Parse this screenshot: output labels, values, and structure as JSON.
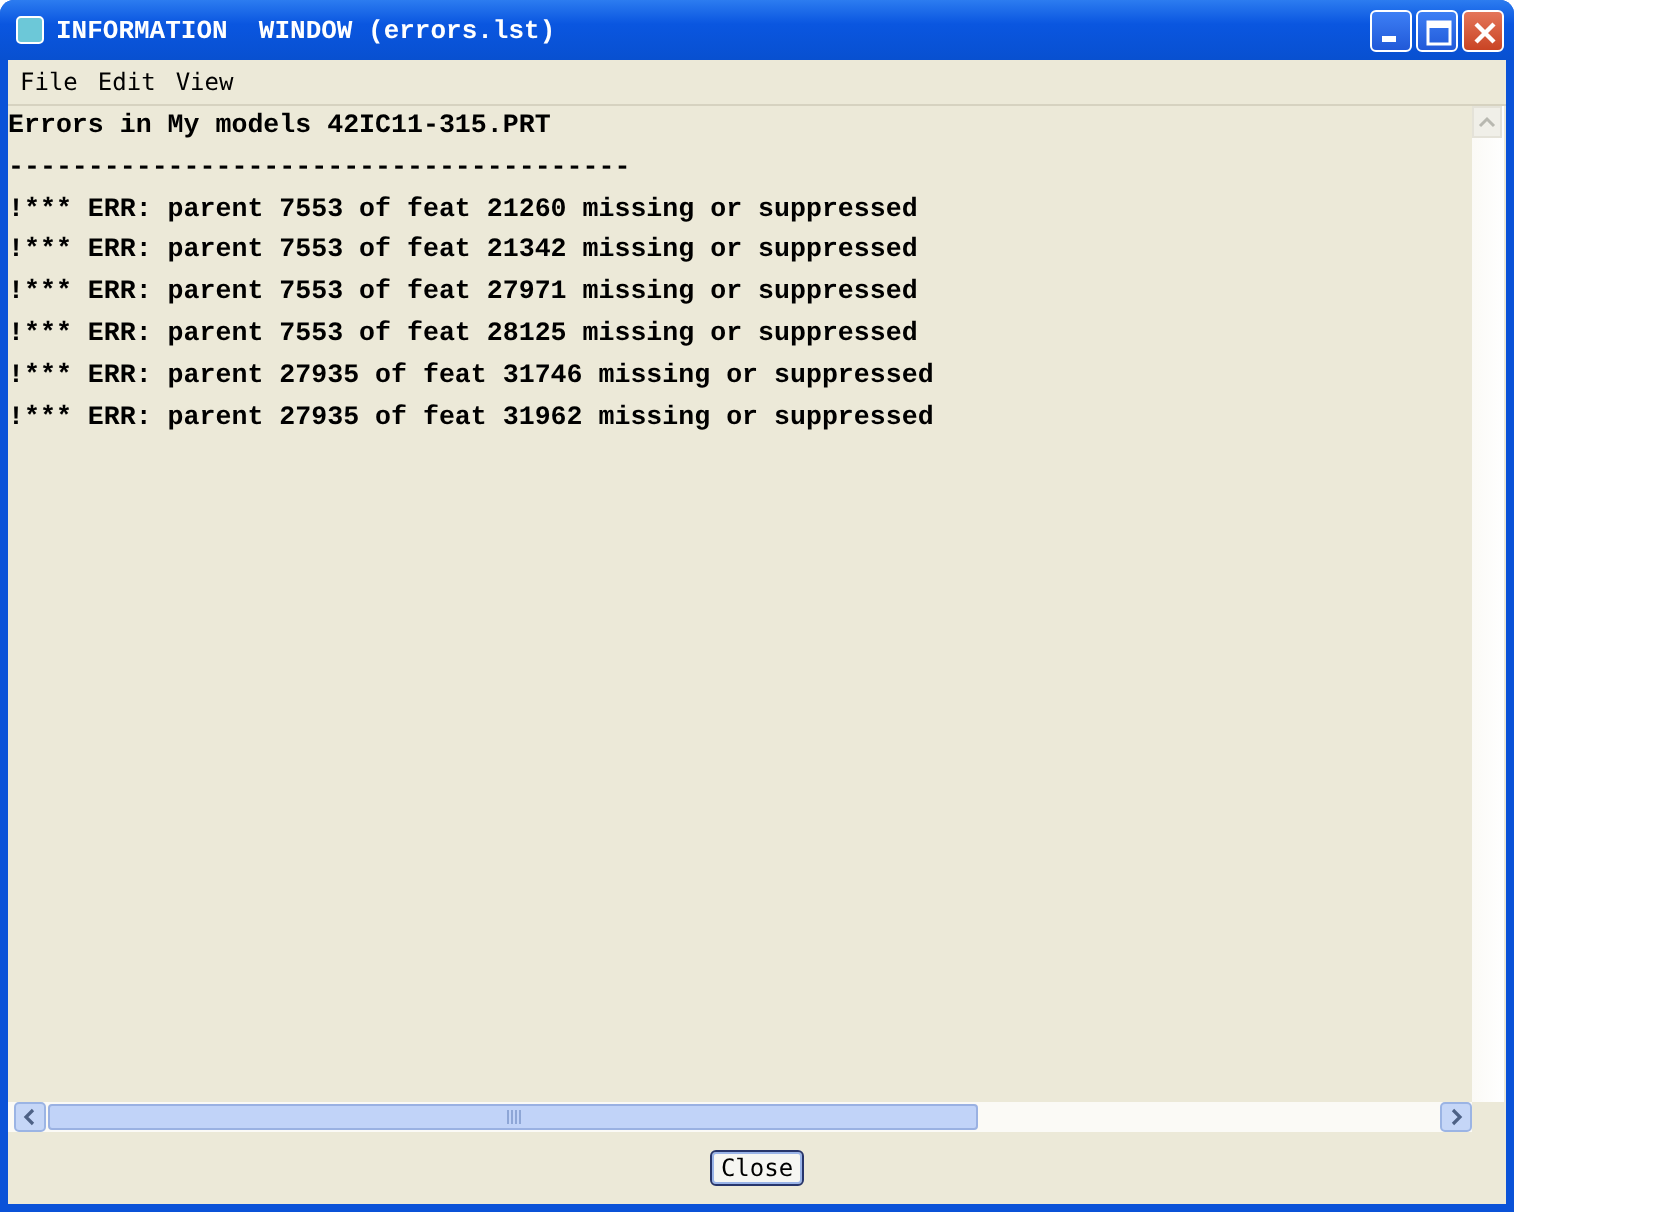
{
  "window": {
    "title": "INFORMATION  WINDOW (errors.lst)"
  },
  "menu": [
    "File",
    "Edit",
    "View"
  ],
  "content": {
    "lines": [
      "Errors in My models 42IC11-315.PRT",
      "---------------------------------------",
      "!*** ERR: parent 7553 of feat 21260 missing or suppressed",
      "!*** ERR: parent 7553 of feat 21342 missing or suppressed",
      "!*** ERR: parent 7553 of feat 27971 missing or suppressed",
      "!*** ERR: parent 7553 of feat 28125 missing or suppressed",
      "!*** ERR: parent 27935 of feat 31746 missing or suppressed",
      "!*** ERR: parent 27935 of feat 31962 missing or suppressed"
    ]
  },
  "buttons": [
    "Close"
  ]
}
